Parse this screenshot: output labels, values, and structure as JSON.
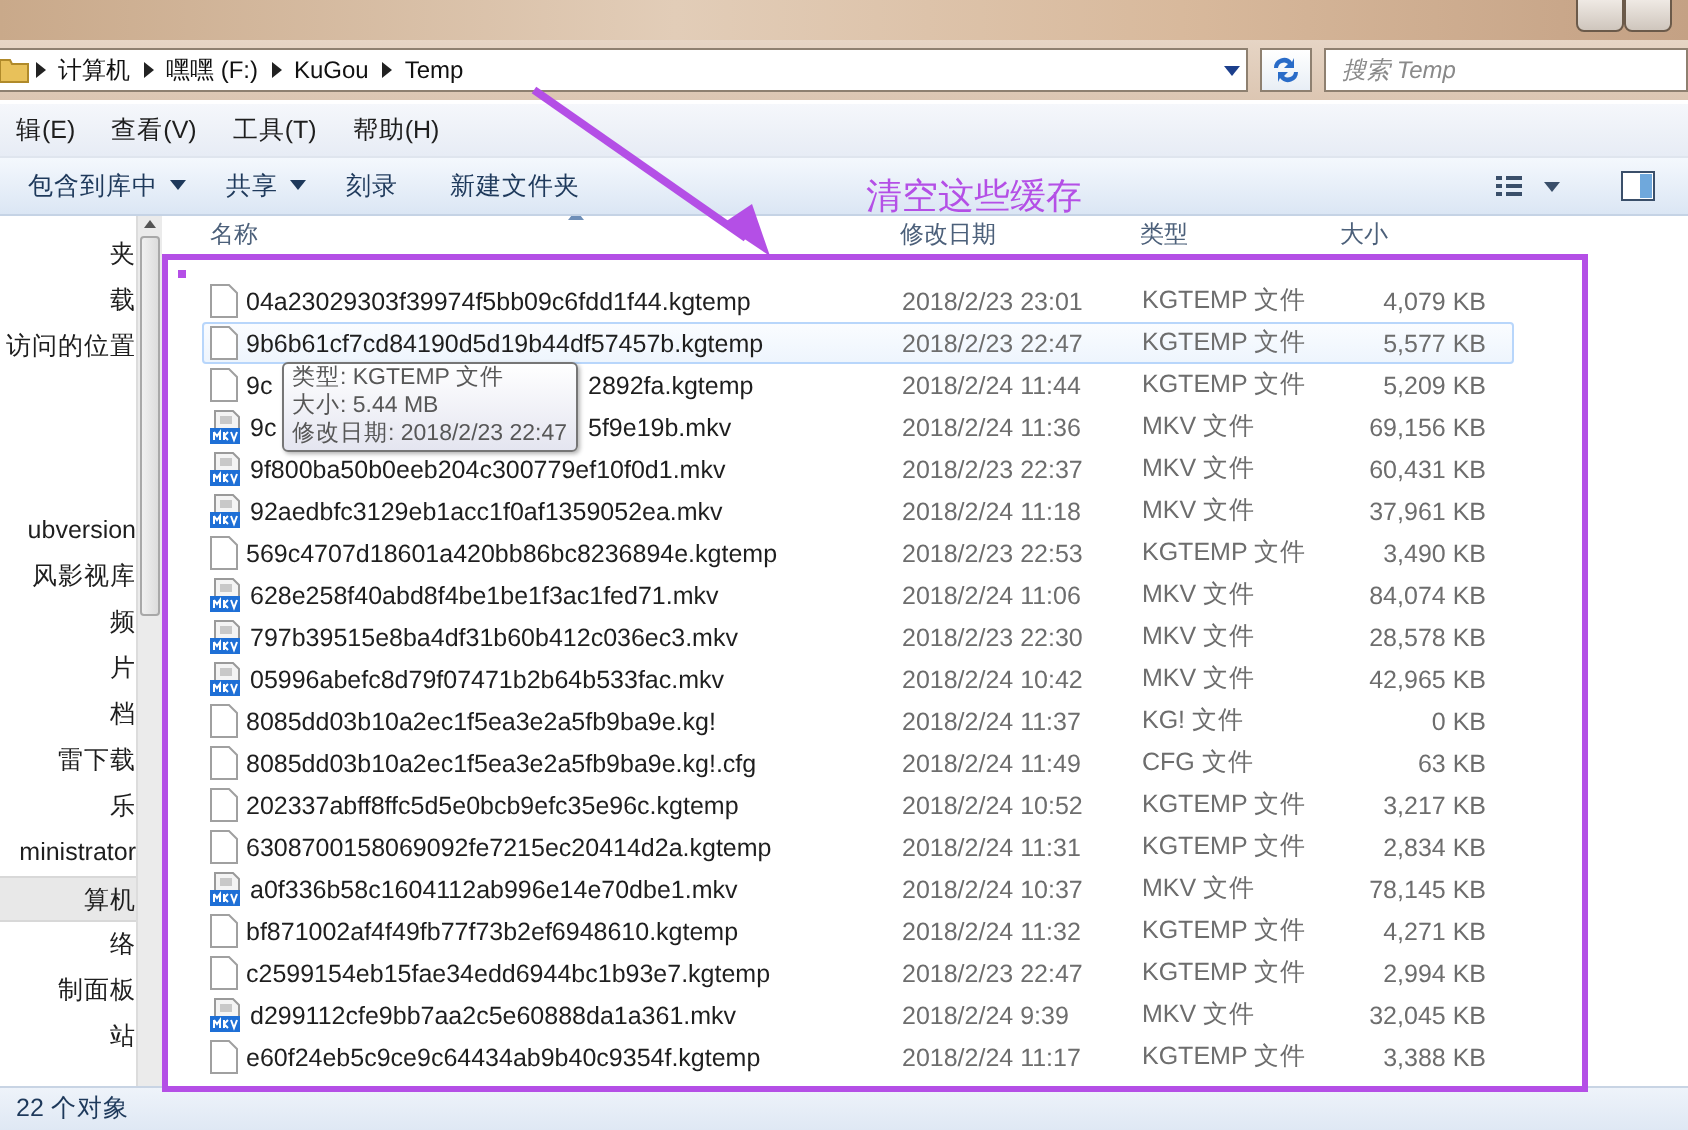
{
  "address_bar": {
    "crumbs": [
      "计算机",
      "嘿嘿 (F:)",
      "KuGou",
      "Temp"
    ]
  },
  "search": {
    "placeholder": "搜索 Temp"
  },
  "menu": [
    "辑(E)",
    "查看(V)",
    "工具(T)",
    "帮助(H)"
  ],
  "toolbar": [
    {
      "label": "包含到库中",
      "dropdown": true
    },
    {
      "label": "共享",
      "dropdown": true
    },
    {
      "label": "刻录",
      "dropdown": false
    },
    {
      "label": "新建文件夹",
      "dropdown": false
    }
  ],
  "nav_pane": {
    "groups": [
      {
        "items": [
          {
            "label": "夹",
            "selected": false
          },
          {
            "label": "载",
            "selected": false
          },
          {
            "label": "访问的位置",
            "selected": false
          }
        ]
      },
      {
        "items": [
          {
            "label": "ubversion",
            "selected": false
          },
          {
            "label": "风影视库",
            "selected": false
          },
          {
            "label": "频",
            "selected": false
          },
          {
            "label": "片",
            "selected": false
          },
          {
            "label": "档",
            "selected": false
          },
          {
            "label": "雷下载",
            "selected": false
          },
          {
            "label": "乐",
            "selected": false
          },
          {
            "label": "ministrator",
            "selected": false
          }
        ]
      },
      {
        "items": [
          {
            "label": "算机",
            "selected": true
          },
          {
            "label": "络",
            "selected": false
          },
          {
            "label": "制面板",
            "selected": false
          },
          {
            "label": "站",
            "selected": false
          }
        ]
      }
    ]
  },
  "columns": [
    "名称",
    "修改日期",
    "类型",
    "大小"
  ],
  "files": [
    {
      "kind": "document",
      "name": "04a23029303f39974f5bb09c6fdd1f44.kgtemp",
      "date": "2018/2/23 23:01",
      "type": "KGTEMP 文件",
      "size": "4,079 KB",
      "highlighted": false
    },
    {
      "kind": "document",
      "name": "9b6b61cf7cd84190d5d19b44df57457b.kgtemp",
      "date": "2018/2/23 22:47",
      "type": "KGTEMP 文件",
      "size": "5,577 KB",
      "highlighted": true
    },
    {
      "kind": "document",
      "name": "9c",
      "name_end": "2892fa.kgtemp",
      "date": "2018/2/24 11:44",
      "type": "KGTEMP 文件",
      "size": "5,209 KB",
      "highlighted": false
    },
    {
      "kind": "video",
      "name": "9c",
      "name_end": "5f9e19b.mkv",
      "date": "2018/2/24 11:36",
      "type": "MKV 文件",
      "size": "69,156 KB",
      "highlighted": false
    },
    {
      "kind": "video",
      "name": "9f800ba50b0eeb204c300779ef10f0d1.mkv",
      "date": "2018/2/23 22:37",
      "type": "MKV 文件",
      "size": "60,431 KB",
      "highlighted": false
    },
    {
      "kind": "video",
      "name": "92aedbfc3129eb1acc1f0af1359052ea.mkv",
      "date": "2018/2/24 11:18",
      "type": "MKV 文件",
      "size": "37,961 KB",
      "highlighted": false
    },
    {
      "kind": "document",
      "name": "569c4707d18601a420bb86bc8236894e.kgtemp",
      "date": "2018/2/23 22:53",
      "type": "KGTEMP 文件",
      "size": "3,490 KB",
      "highlighted": false
    },
    {
      "kind": "video",
      "name": "628e258f40abd8f4be1be1f3ac1fed71.mkv",
      "date": "2018/2/24 11:06",
      "type": "MKV 文件",
      "size": "84,074 KB",
      "highlighted": false
    },
    {
      "kind": "video",
      "name": "797b39515e8ba4df31b60b412c036ec3.mkv",
      "date": "2018/2/23 22:30",
      "type": "MKV 文件",
      "size": "28,578 KB",
      "highlighted": false
    },
    {
      "kind": "video",
      "name": "05996abefc8d79f07471b2b64b533fac.mkv",
      "date": "2018/2/24 10:42",
      "type": "MKV 文件",
      "size": "42,965 KB",
      "highlighted": false
    },
    {
      "kind": "document",
      "name": "8085dd03b10a2ec1f5ea3e2a5fb9ba9e.kg!",
      "date": "2018/2/24 11:37",
      "type": "KG! 文件",
      "size": "0 KB",
      "highlighted": false
    },
    {
      "kind": "document",
      "name": "8085dd03b10a2ec1f5ea3e2a5fb9ba9e.kg!.cfg",
      "date": "2018/2/24 11:49",
      "type": "CFG 文件",
      "size": "63 KB",
      "highlighted": false
    },
    {
      "kind": "document",
      "name": "202337abff8ffc5d5e0bcb9efc35e96c.kgtemp",
      "date": "2018/2/24 10:52",
      "type": "KGTEMP 文件",
      "size": "3,217 KB",
      "highlighted": false
    },
    {
      "kind": "document",
      "name": "6308700158069092fe7215ec20414d2a.kgtemp",
      "date": "2018/2/24 11:31",
      "type": "KGTEMP 文件",
      "size": "2,834 KB",
      "highlighted": false
    },
    {
      "kind": "video",
      "name": "a0f336b58c1604112ab996e14e70dbe1.mkv",
      "date": "2018/2/24 10:37",
      "type": "MKV 文件",
      "size": "78,145 KB",
      "highlighted": false
    },
    {
      "kind": "document",
      "name": "bf871002af4f49fb77f73b2ef6948610.kgtemp",
      "date": "2018/2/24 11:32",
      "type": "KGTEMP 文件",
      "size": "4,271 KB",
      "highlighted": false
    },
    {
      "kind": "document",
      "name": "c2599154eb15fae34edd6944bc1b93e7.kgtemp",
      "date": "2018/2/23 22:47",
      "type": "KGTEMP 文件",
      "size": "2,994 KB",
      "highlighted": false
    },
    {
      "kind": "video",
      "name": "d299112cfe9bb7aa2c5e60888da1a361.mkv",
      "date": "2018/2/24 9:39",
      "type": "MKV 文件",
      "size": "32,045 KB",
      "highlighted": false
    },
    {
      "kind": "document",
      "name": "e60f24eb5c9ce9c64434ab9b40c9354f.kgtemp",
      "date": "2018/2/24 11:17",
      "type": "KGTEMP 文件",
      "size": "3,388 KB",
      "highlighted": false
    }
  ],
  "tooltip": [
    "类型: KGTEMP 文件",
    "大小: 5.44 MB",
    "修改日期: 2018/2/23 22:47"
  ],
  "annotation": {
    "text": "清空这些缓存"
  },
  "status_bar": {
    "text": "22 个对象"
  }
}
